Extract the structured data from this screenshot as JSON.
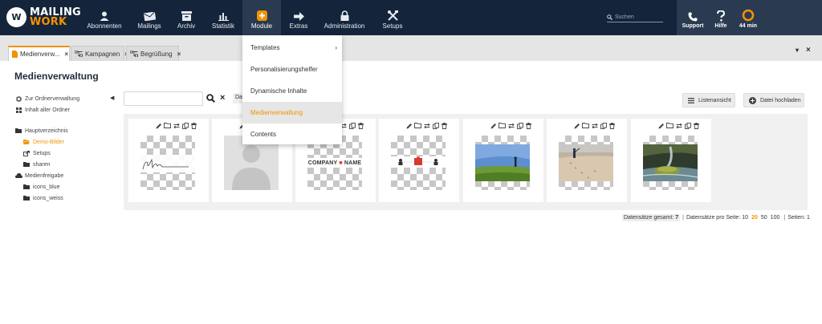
{
  "brand": {
    "line1": "MAILING",
    "line2": "WORK",
    "mark": "W"
  },
  "nav": [
    {
      "label": "Abonnenten",
      "icon": "user-icon"
    },
    {
      "label": "Mailings",
      "icon": "mail-icon"
    },
    {
      "label": "Archiv",
      "icon": "archive-icon"
    },
    {
      "label": "Statistik",
      "icon": "bar-chart-icon"
    },
    {
      "label": "Module",
      "icon": "puzzle-icon",
      "active": true
    },
    {
      "label": "Extras",
      "icon": "arrow-right-icon"
    },
    {
      "label": "Administration",
      "icon": "lock-icon"
    },
    {
      "label": "Setups",
      "icon": "tools-icon"
    }
  ],
  "search": {
    "placeholder": "Suchen"
  },
  "right_nav": [
    {
      "label": "Support",
      "icon": "phone-icon"
    },
    {
      "label": "Hilfe",
      "icon": "question-icon"
    },
    {
      "label": "44 min",
      "icon": "session-timer-icon"
    }
  ],
  "tabs": [
    {
      "label": "Medienverw...",
      "icon": "document-icon",
      "active": true
    },
    {
      "label": "Kampagnen",
      "icon": "flow-icon"
    },
    {
      "label": "Begrüßung",
      "icon": "flow-icon"
    }
  ],
  "tab_controls": {
    "menu": "▾",
    "close": "×"
  },
  "page": {
    "title": "Medienverwaltung"
  },
  "sidebar": {
    "top_items": [
      {
        "label": "Zur Ordnerverwaltung",
        "icon": "gear-icon"
      },
      {
        "label": "Inhalt aller Ordner",
        "icon": "grid-icon"
      }
    ],
    "tree": [
      {
        "label": "Hauptverzeichnis",
        "icon": "folder-icon",
        "indent": false,
        "selected": false
      },
      {
        "label": "Demo-Bilder",
        "icon": "folder-open-icon",
        "indent": true,
        "selected": true
      },
      {
        "label": "Setups",
        "icon": "share-icon",
        "indent": true,
        "selected": false
      },
      {
        "label": "sharen",
        "icon": "folder-icon",
        "indent": true,
        "selected": false
      },
      {
        "label": "Medienfreigabe",
        "icon": "cloud-icon",
        "indent": false,
        "selected": false
      },
      {
        "label": "icons_blue",
        "icon": "folder-icon",
        "indent": true,
        "selected": false
      },
      {
        "label": "icons_weiss",
        "icon": "folder-icon",
        "indent": true,
        "selected": false
      }
    ]
  },
  "filter": {
    "value": "",
    "cut_label": "Da"
  },
  "buttons": {
    "list_view": "Listenansicht",
    "upload": "Datei hochladen"
  },
  "media": [
    {
      "name": "signature",
      "kind": "signature"
    },
    {
      "name": "avatar",
      "kind": "avatar"
    },
    {
      "name": "company-logo",
      "kind": "company",
      "text_left": "COMPANY",
      "text_right": "NAME"
    },
    {
      "name": "icon-row",
      "kind": "icons"
    },
    {
      "name": "person-field",
      "kind": "photo-field"
    },
    {
      "name": "person-beach",
      "kind": "photo-beach"
    },
    {
      "name": "waterfall-stone",
      "kind": "photo-water"
    }
  ],
  "pager": {
    "total_label": "Datensätze gesamt:",
    "total": "7",
    "per_page_label": "Datensätze pro Seite:",
    "options": [
      "10",
      "20",
      "50",
      "100"
    ],
    "active_option": "20",
    "pages_label": "Seiten:",
    "pages": "1"
  },
  "module_menu": [
    {
      "label": "Templates",
      "submenu": true
    },
    {
      "label": "Personalisierungshelfer",
      "submenu": false
    },
    {
      "label": "Dynamische Inhalte",
      "submenu": false
    },
    {
      "label": "Medienverwaltung",
      "submenu": false,
      "highlighted": true
    },
    {
      "label": "Contents",
      "submenu": false
    }
  ],
  "colors": {
    "navy": "#14253b",
    "accent": "#f39200",
    "nav_active": "#2a3a51"
  }
}
